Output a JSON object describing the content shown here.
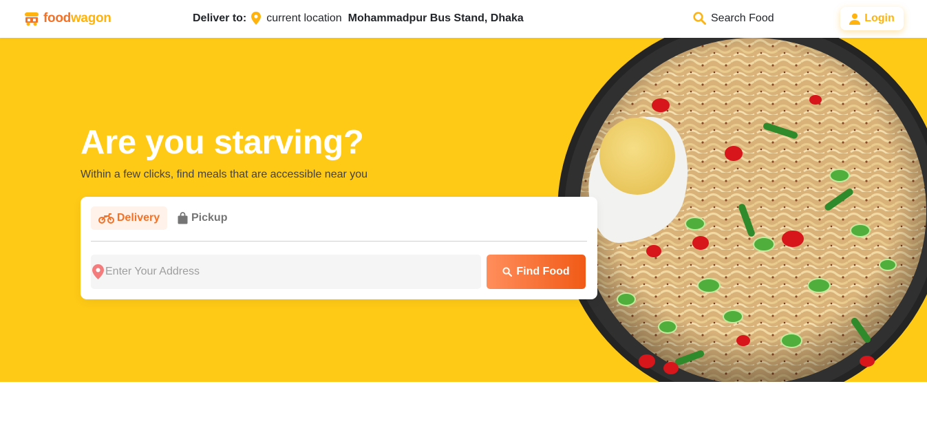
{
  "nav": {
    "logo_part1": "food",
    "logo_part2": "wagon",
    "deliver_label": "Deliver to:",
    "current_location": "current location",
    "address": "Mohammadpur Bus Stand, Dhaka",
    "search_label": "Search Food",
    "login_label": "Login"
  },
  "hero": {
    "title": "Are you starving?",
    "subtitle": "Within a few clicks, find meals that are accessible near you"
  },
  "search_card": {
    "tabs": [
      {
        "label": "Delivery",
        "icon": "motorcycle-icon",
        "active": true
      },
      {
        "label": "Pickup",
        "icon": "shopping-bag-icon",
        "active": false
      }
    ],
    "address_placeholder": "Enter Your Address",
    "find_label": "Find Food"
  },
  "colors": {
    "brand_orange": "#f17228",
    "brand_yellow": "#ffb30e",
    "hero_bg": "#ffca16"
  }
}
